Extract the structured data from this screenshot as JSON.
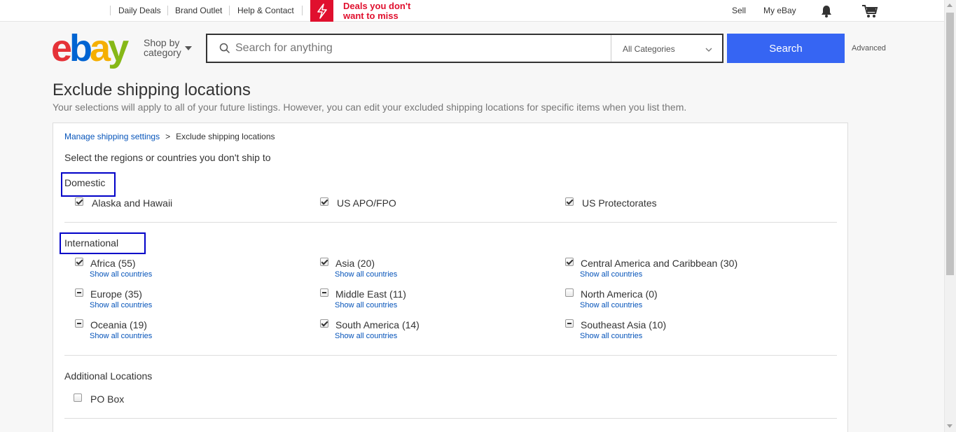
{
  "topbar": {
    "links": [
      "Daily Deals",
      "Brand Outlet",
      "Help & Contact"
    ],
    "deal_text_line1": "Deals you don't",
    "deal_text_line2": "want to miss",
    "sell": "Sell",
    "my_ebay": "My eBay"
  },
  "header": {
    "logo": [
      "e",
      "b",
      "a",
      "y"
    ],
    "shop_by_line1": "Shop by",
    "shop_by_line2": "category",
    "search_placeholder": "Search for anything",
    "category_selected": "All Categories",
    "search_button": "Search",
    "advanced": "Advanced"
  },
  "page": {
    "title": "Exclude shipping locations",
    "subtitle": "Your selections will apply to all of your future listings. However, you can edit your excluded shipping locations for specific items when you list them."
  },
  "breadcrumb": {
    "parent": "Manage shipping settings",
    "separator": ">",
    "current": "Exclude shipping locations"
  },
  "instruction": "Select the regions or countries you don't ship to",
  "domestic": {
    "label": "Domestic",
    "items": [
      {
        "label": "Alaska and Hawaii",
        "state": "checked"
      },
      {
        "label": "US APO/FPO",
        "state": "checked"
      },
      {
        "label": "US Protectorates",
        "state": "checked"
      }
    ]
  },
  "international": {
    "label": "International",
    "show_all": "Show all countries",
    "items": [
      {
        "label": "Africa (55)",
        "state": "checked"
      },
      {
        "label": "Asia (20)",
        "state": "checked"
      },
      {
        "label": "Central America and Caribbean (30)",
        "state": "checked"
      },
      {
        "label": "Europe (35)",
        "state": "mixed"
      },
      {
        "label": "Middle East (11)",
        "state": "mixed"
      },
      {
        "label": "North America (0)",
        "state": "unchecked"
      },
      {
        "label": "Oceania (19)",
        "state": "mixed"
      },
      {
        "label": "South America (14)",
        "state": "checked"
      },
      {
        "label": "Southeast Asia (10)",
        "state": "mixed"
      }
    ]
  },
  "additional": {
    "label": "Additional Locations",
    "items": [
      {
        "label": "PO Box",
        "state": "unchecked"
      }
    ]
  },
  "colors": {
    "search_button": "#3665f3",
    "link": "#0654ba",
    "deal_red": "#e0102e",
    "highlight_box": "#0000c8"
  }
}
